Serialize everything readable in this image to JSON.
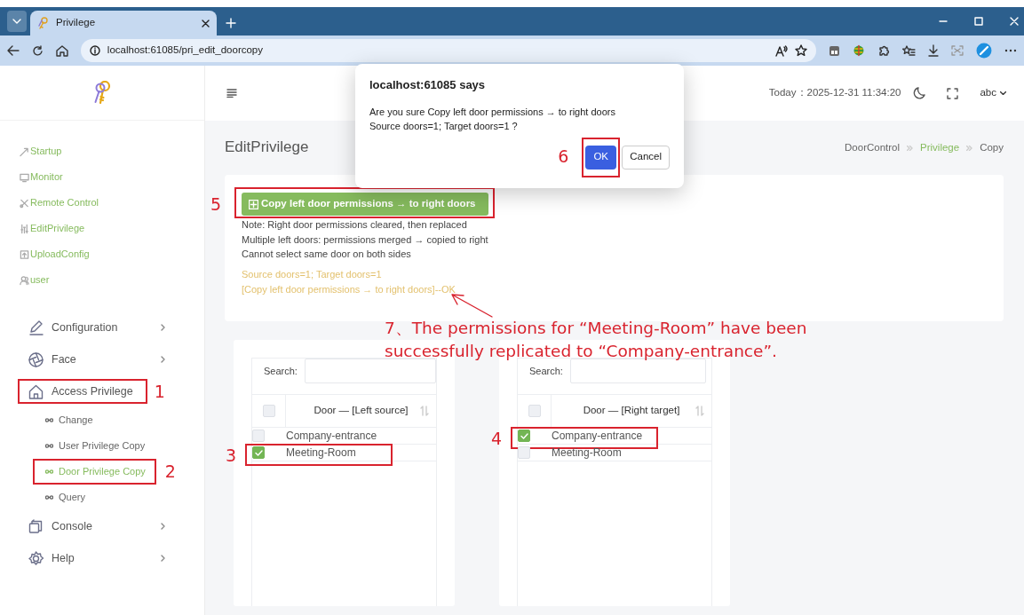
{
  "browser": {
    "tab_title": "Privilege",
    "url": "localhost:61085/pri_edit_doorcopy"
  },
  "header": {
    "date": "Today：2025-12-31 11:34:20",
    "user": "abc"
  },
  "sidebar": {
    "shortcuts": [
      "Startup",
      "Monitor",
      "Remote Control",
      "EditPrivilege",
      "UploadConfig",
      "user"
    ],
    "menu": [
      {
        "label": "Configuration",
        "expanded": false
      },
      {
        "label": "Face",
        "expanded": false
      },
      {
        "label": "Access Privilege",
        "expanded": true,
        "callout": "1",
        "children": [
          {
            "label": "Change",
            "selected": false
          },
          {
            "label": "User Privilege Copy",
            "selected": false
          },
          {
            "label": "Door Privilege Copy",
            "selected": true,
            "callout": "2"
          },
          {
            "label": "Query",
            "selected": false
          }
        ]
      },
      {
        "label": "Console",
        "expanded": false
      },
      {
        "label": "Help",
        "expanded": false
      }
    ]
  },
  "page": {
    "title": "EditPrivilege",
    "breadcrumb": [
      {
        "label": "DoorControl",
        "kind": "text"
      },
      {
        "label": "Privilege",
        "kind": "link"
      },
      {
        "label": "Copy",
        "kind": "text"
      }
    ]
  },
  "copy_panel": {
    "button": {
      "label": "Copy left door permissions → to right doors",
      "callout": "5"
    },
    "notes": [
      "Note: Right door permissions cleared, then replaced",
      "Multiple left doors: permissions merged → copied to right",
      "Cannot select same door on both sides"
    ],
    "status_lines": [
      "Source doors=1; Target doors=1",
      "[Copy left door permissions → to right doors]--OK"
    ]
  },
  "tables": [
    {
      "search_label": "Search:",
      "column": "Door — [Left source]",
      "all_checked": false,
      "rows": [
        {
          "name": "Company-entrance",
          "checked": false
        },
        {
          "name": "Meeting-Room",
          "checked": true,
          "callout": "3"
        }
      ]
    },
    {
      "search_label": "Search:",
      "column": "Door — [Right target]",
      "all_checked": false,
      "rows": [
        {
          "name": "Company-entrance",
          "checked": true,
          "callout": "4"
        },
        {
          "name": "Meeting-Room",
          "checked": false
        }
      ]
    }
  ],
  "dialog": {
    "title": "localhost:61085 says",
    "message_lines": [
      "Are you sure Copy left door permissions → to right doors",
      "Source doors=1; Target doors=1 ?"
    ],
    "ok": {
      "label": "OK",
      "callout": "6"
    },
    "cancel": "Cancel"
  },
  "annotation_note": "7、The permissions for “Meeting-Room” have been successfully replicated to “Company-entrance”."
}
